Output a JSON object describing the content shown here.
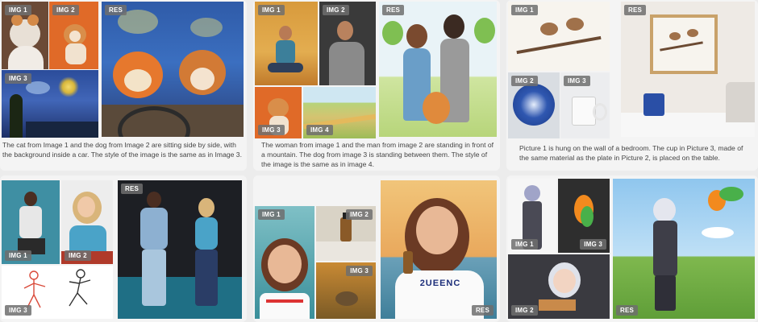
{
  "labels": {
    "img1": "IMG 1",
    "img2": "IMG 2",
    "img3": "IMG 3",
    "img4": "IMG 4",
    "res": "RES"
  },
  "examples": [
    {
      "caption": "The cat from Image 1 and the dog from Image 2 are sitting side by side, with the background inside a car. The style of the image is the same as in Image 3."
    },
    {
      "caption": "The woman from image 1 and the man from image 2 are standing in front of a mountain. The dog from image 3 is standing between them. The style of the image is the same as in image 4."
    },
    {
      "caption": "Picture 1 is hung on the wall of a bedroom. The cup in Picture 3, made of the same material as the plate in Picture 2, is placed on the table."
    },
    {
      "caption": ""
    },
    {
      "caption": ""
    },
    {
      "caption": ""
    }
  ],
  "tshirt_text": "2UEENC",
  "colors": {
    "card_bg": "#f4f4f4",
    "page_bg": "#ececec",
    "tag_bg": "#6e6e6e"
  }
}
